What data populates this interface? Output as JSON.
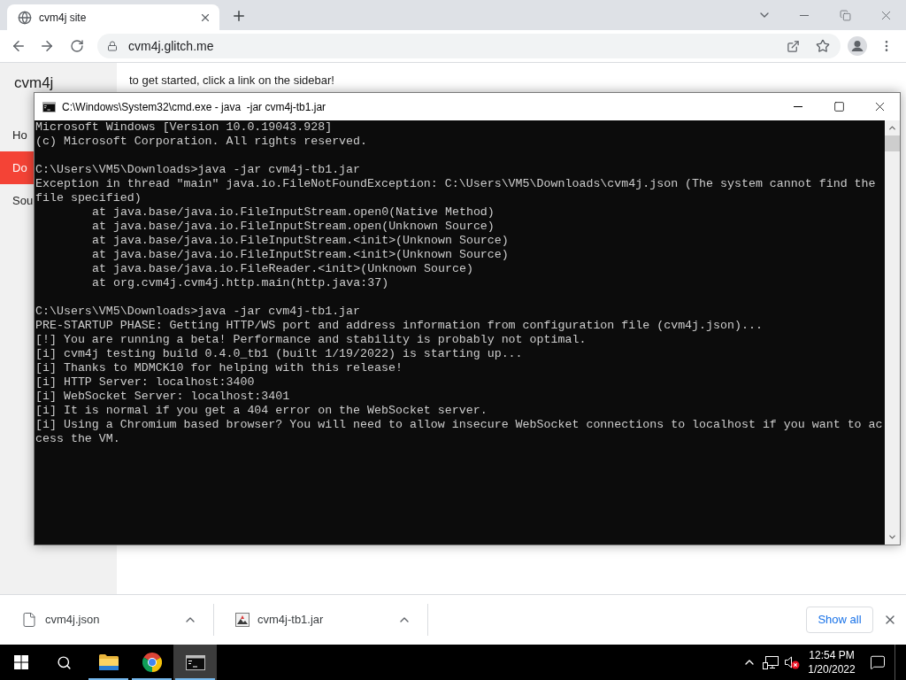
{
  "browser": {
    "tabs": [
      {
        "title": "cvm4j site",
        "selected": true
      }
    ],
    "address": "cvm4j.glitch.me"
  },
  "page": {
    "sidebar": {
      "title": "cvm4j",
      "items": [
        {
          "label": "Ho",
          "selected": false
        },
        {
          "label": "Do",
          "selected": true
        },
        {
          "label": "Sou",
          "selected": false
        }
      ]
    },
    "content": "to get started, click a link on the sidebar!"
  },
  "console_window": {
    "title": "C:\\Windows\\System32\\cmd.exe - java  -jar cvm4j-tb1.jar",
    "blocks": [
      [
        {
          "text": "Microsoft Windows [Version 10.0.19043.928]"
        },
        {
          "text": "(c) Microsoft Corporation. All rights reserved."
        }
      ],
      [
        {
          "text": "C:\\Users\\VM5\\Downloads>java -jar cvm4j-tb1.jar"
        },
        {
          "text": "Exception in thread \"main\" java.io.FileNotFoundException: C:\\Users\\VM5\\Downloads\\cvm4j.json (The system cannot find the file specified)",
          "children": [
            {
              "text": "at java.base/java.io.FileInputStream.open0(Native Method)"
            },
            {
              "text": "at java.base/java.io.FileInputStream.open(Unknown Source)"
            },
            {
              "text": "at java.base/java.io.FileInputStream.<init>(Unknown Source)"
            },
            {
              "text": "at java.base/java.io.FileInputStream.<init>(Unknown Source)"
            },
            {
              "text": "at java.base/java.io.FileReader.<init>(Unknown Source)"
            },
            {
              "text": "at org.cvm4j.cvm4j.http.main(http.java:37)"
            }
          ]
        }
      ],
      [
        {
          "text": "C:\\Users\\VM5\\Downloads>java -jar cvm4j-tb1.jar"
        },
        {
          "text": "PRE-STARTUP PHASE: Getting HTTP/WS port and address information from configuration file (cvm4j.json)..."
        },
        {
          "text": "[!] You are running a beta! Performance and stability is probably not optimal."
        },
        {
          "text": "[i] cvm4j testing build 0.4.0_tb1 (built 1/19/2022) is starting up..."
        },
        {
          "text": "[i] Thanks to MDMCK10 for helping with this release!"
        },
        {
          "text": "[i] HTTP Server: localhost:3400"
        },
        {
          "text": "[i] WebSocket Server: localhost:3401"
        },
        {
          "text": "[i] It is normal if you get a 404 error on the WebSocket server."
        },
        {
          "text": "[i] Using a Chromium based browser? You will need to allow insecure WebSocket connections to localhost if you want to access the VM."
        }
      ]
    ]
  },
  "downloads": {
    "items": [
      {
        "name": "cvm4j.json",
        "kind": "text"
      },
      {
        "name": "cvm4j-tb1.jar",
        "kind": "jar"
      }
    ],
    "show_all_label": "Show all"
  },
  "taskbar": {
    "apps": [
      {
        "kind": "folder",
        "running": true,
        "selected": false
      },
      {
        "kind": "browser",
        "running": true,
        "selected": false
      },
      {
        "kind": "terminal",
        "running": true,
        "selected": true
      }
    ],
    "volume_muted": true,
    "time": "12:54 PM",
    "date": "1/20/2022"
  }
}
